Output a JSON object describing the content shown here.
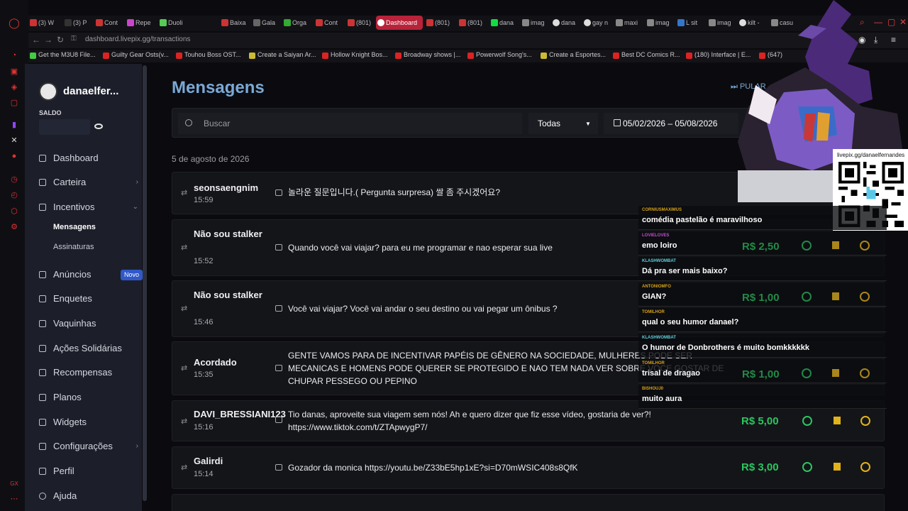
{
  "browser": {
    "tabs": [
      {
        "label": "(3) W"
      },
      {
        "label": "(3) P"
      },
      {
        "label": "Cont"
      },
      {
        "label": "Repe"
      },
      {
        "label": "Duoli"
      },
      {
        "label": "Baixa"
      },
      {
        "label": "Gala"
      },
      {
        "label": "Orga"
      },
      {
        "label": "Cont"
      },
      {
        "label": "(801)"
      },
      {
        "label": "Dashboard"
      },
      {
        "label": "(801)"
      },
      {
        "label": "(801)"
      },
      {
        "label": "dana"
      },
      {
        "label": "imag"
      },
      {
        "label": "dana"
      },
      {
        "label": "gay n"
      },
      {
        "label": "maxi"
      },
      {
        "label": "imag"
      },
      {
        "label": "L sit"
      },
      {
        "label": "imag"
      },
      {
        "label": "kilt -"
      },
      {
        "label": "casu"
      }
    ],
    "url": "dashboard.livepix.gg/transactions",
    "bookmarks": [
      "Get the M3U8 File...",
      "Guilty Gear Osts(v...",
      "Touhou Boss OST...",
      "Create a Saiyan Ar...",
      "Hollow Knight Bos...",
      "Broadway shows |...",
      "Powerwolf Song's...",
      "Create a Esportes...",
      "Best DC Comics R...",
      "(180) Interface | E...",
      "(647)"
    ]
  },
  "sidebar": {
    "username": "danaelfer...",
    "saldo_label": "SALDO",
    "items": [
      {
        "label": "Dashboard"
      },
      {
        "label": "Carteira"
      },
      {
        "label": "Incentivos"
      },
      {
        "label": "Anúncios"
      },
      {
        "label": "Enquetes"
      },
      {
        "label": "Vaquinhas"
      },
      {
        "label": "Ações Solidárias"
      },
      {
        "label": "Recompensas"
      },
      {
        "label": "Planos"
      },
      {
        "label": "Widgets"
      },
      {
        "label": "Configurações"
      },
      {
        "label": "Perfil"
      },
      {
        "label": "Ajuda"
      }
    ],
    "submenu": [
      "Mensagens",
      "Assinaturas"
    ],
    "badge_novo": "Novo"
  },
  "main": {
    "title": "Mensagens",
    "pular": "PULAR",
    "search_placeholder": "Buscar",
    "filter_value": "Todas",
    "date_range": "05/02/2026 – 05/08/2026",
    "date_heading": "5 de agosto de 2026",
    "messages": [
      {
        "name": "seonsaengnim",
        "time": "15:59",
        "text": "놀라운 질문입니다.( Pergunta surpresa) 쌀 좀 주시겠어요?"
      },
      {
        "name": "Não sou stalker",
        "time": "15:52",
        "text": "Quando você vai viajar? para eu me programar e nao esperar sua live"
      },
      {
        "name": "Não sou stalker",
        "time": "15:46",
        "text": "Você vai viajar? Você vai andar o seu destino ou vai pegar um ônibus ?"
      },
      {
        "name": "Acordado",
        "time": "15:35",
        "text": "GENTE VAMOS PARA DE INCENTIVAR PAPÉIS DE GÊNERO NA SOCIEDADE, MULHERES PODE SER MECANICAS E HOMENS PODE QUERER SE PROTEGIDO E NAO TEM NADA VER SOBRE VOCE GOSTAR DE CHUPAR PESSEGO OU PEPINO"
      },
      {
        "name": "DAVI_BRESSIANI123",
        "time": "15:16",
        "text": "Tio danas, aproveite sua viagem sem nós! Ah e quero dizer que fiz esse vídeo, gostaria de ver?! https://www.tiktok.com/t/ZTApwygP7/",
        "amount": "R$ 5,00"
      },
      {
        "name": "Galirdi",
        "time": "15:14",
        "text": "Gozador da monica https://youtu.be/Z33bE5hp1xE?si=D70mWSIC408s8QfK",
        "amount": "R$ 3,00"
      }
    ]
  },
  "overlay": {
    "qr_label": "livepix.gg/danaelfernandes",
    "chat": [
      {
        "user": "CORNIUSMAXIMUS",
        "text": "comédia pastelão é maravilhoso"
      },
      {
        "user": "LOVIELOVES",
        "text": "emo loiro",
        "amount": "R$ 2,50"
      },
      {
        "user": "KLASHWOMBAT",
        "text": "Dá pra ser mais baixo?"
      },
      {
        "user": "ANTONIOMFO",
        "text": "GIAN?",
        "amount": "R$ 1,00"
      },
      {
        "user": "TOMILHOR",
        "text": "qual o seu humor danael?"
      },
      {
        "user": "KLASHWOMBAT",
        "text": "O humor de Donbrothers é muito bomkkkkkk"
      },
      {
        "user": "TOMILHOR",
        "text": "trisal de dragao",
        "amount": "R$ 1,00"
      },
      {
        "user": "BISHOUJ0",
        "text": "muito aura"
      }
    ]
  },
  "colors": {
    "accent": "#7aa9d6",
    "money": "#2cc55f",
    "flag": "#e1b21a",
    "sidebar": "#1c1f2a",
    "active_tab": "#b8233a"
  }
}
